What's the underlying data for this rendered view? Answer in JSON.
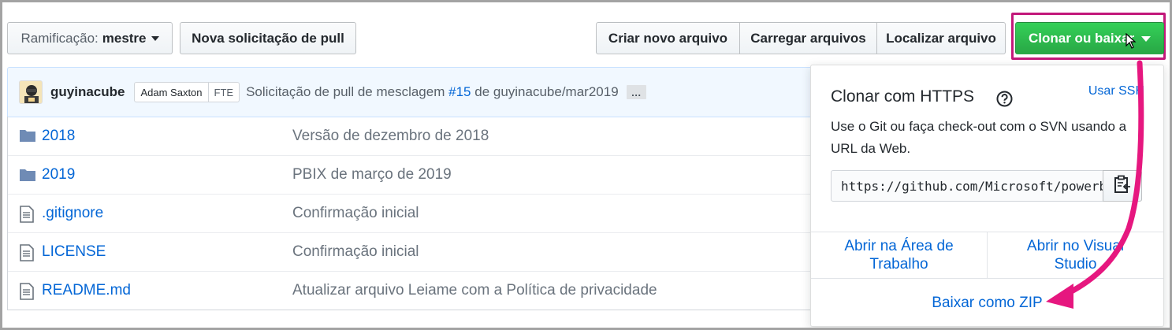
{
  "toolbar": {
    "branch_label": "Ramificação:",
    "branch_value": "mestre",
    "new_pull_label": "Nova solicitação de pull",
    "create_file_label": "Criar novo arquivo",
    "upload_files_label": "Carregar arquivos",
    "find_file_label": "Localizar arquivo",
    "clone_label": "Clonar ou baixar"
  },
  "commit": {
    "author": "guyinacube",
    "coauthor_label": "Adam Saxton",
    "coauthor_tag": "FTE",
    "message_prefix": "Solicitação de pull de mesclagem",
    "pr_link": "#15",
    "message_suffix": "de guyinacube/mar2019",
    "ellipsis": "…"
  },
  "files": [
    {
      "name": "2018",
      "type": "folder",
      "message": "Versão de dezembro de 2018"
    },
    {
      "name": "2019",
      "type": "folder",
      "message": "PBIX de março de 2019"
    },
    {
      "name": ".gitignore",
      "type": "file",
      "message": "Confirmação inicial"
    },
    {
      "name": "LICENSE",
      "type": "file",
      "message": "Confirmação inicial"
    },
    {
      "name": "README.md",
      "type": "file",
      "message": "Atualizar arquivo Leiame com a Política de privacidade"
    }
  ],
  "clone_popover": {
    "title": "Clonar com HTTPS",
    "use_ssh": "Usar SSH",
    "description": "Use o Git ou faça check-out com o SVN usando a URL da Web.",
    "url": "https://github.com/Microsoft/powerbi-desktop-samples.git",
    "open_desktop": "Abrir na Área de Trabalho",
    "open_vs": "Abrir no Visual Studio",
    "download_zip": "Baixar como ZIP"
  },
  "colors": {
    "link": "#0366d6",
    "clone_green": "#28a745",
    "annotation_pink": "#e6177f"
  }
}
